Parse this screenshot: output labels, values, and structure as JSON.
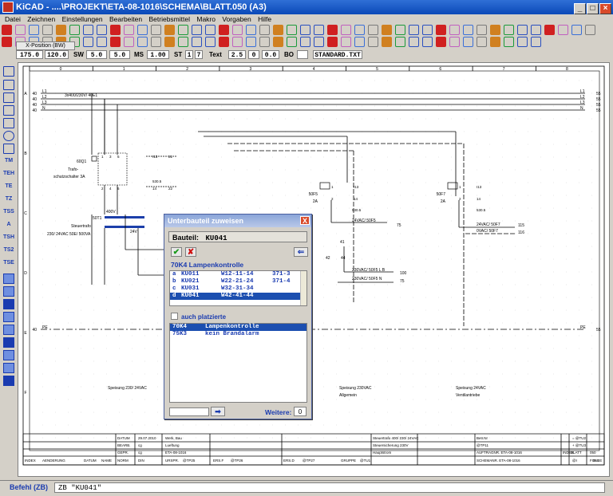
{
  "window": {
    "title": "KiCAD - ....\\PROJEKT\\ETA-08-1016\\SCHEMA\\BLATT.050 (A3)"
  },
  "menu": [
    "Datei",
    "Zeichnen",
    "Einstellungen",
    "Bearbeiten",
    "Betriebsmittel",
    "Makro",
    "Vorgaben",
    "Hilfe"
  ],
  "xpos_label": "X-Position (BW)",
  "status": {
    "v1": "175.0",
    "v2": "120.0",
    "sw_label": "SW",
    "sw": "5.0",
    "sw2": "5.0",
    "ms_label": "MS",
    "ms": "1.00",
    "st_label": "ST",
    "st1": "1",
    "st2": "7",
    "text_label": "Text",
    "text_size": "2.5",
    "tx1": "0",
    "tx2": "0.0",
    "bo_label": "BO",
    "font": "STANDARD.TXT"
  },
  "left_tools": [
    "TM",
    "TEH",
    "TE",
    "TZ",
    "TSS",
    "A",
    "TSH",
    "TS2",
    "TSE"
  ],
  "schematic": {
    "col_numbers": [
      "0",
      "1",
      "2",
      "3",
      "4",
      "5",
      "6",
      "7",
      "8"
    ],
    "row_letters": [
      "A",
      "B",
      "C",
      "D",
      "E",
      "F"
    ],
    "bus_label": "3x400/230V/ 40E1",
    "bus_left": [
      "L1",
      "L2",
      "L3",
      "N",
      "PE"
    ],
    "bus_right": [
      "L1",
      "L2",
      "L3",
      "N",
      "PE"
    ],
    "bus_refs": [
      "40",
      "40",
      "40",
      "40",
      "40"
    ],
    "bus_refs_right": [
      "55",
      "55",
      "55",
      "55",
      "55"
    ],
    "q1": {
      "name": "60Q1",
      "desc1": "Trafo-",
      "desc2": "schutzschalter 3A",
      "pins_top": [
        "1",
        "3",
        "5",
        "I13",
        "21"
      ],
      "pins_bot": [
        "2",
        "4",
        "6",
        "14",
        "22"
      ],
      "ref": "530.5"
    },
    "t1": {
      "name": "50T1",
      "desc1": "Steuertrafo",
      "desc2": "230/ 24VAC  50E/ 500VA",
      "v_in": "400V",
      "v_out": "24V"
    },
    "f5": {
      "name": "50F5",
      "rating": "2A",
      "pins": [
        "1",
        "I13",
        "2",
        "14"
      ],
      "ref": "530.5",
      "l1": "24VAC/ 50F5",
      "l1n": "75",
      "c1": "41",
      "c2": "42",
      "c3": "44",
      "l2": "230VAC/ 50F5 L B",
      "l2n": "100",
      "l3": "230VAC/ 50F5 N",
      "l3n": "75"
    },
    "f7": {
      "name": "50F7",
      "rating": "2A",
      "pins": [
        "1",
        "I13",
        "2",
        "14"
      ],
      "ref": "530.5",
      "l1": "24VAC/ 50F7",
      "l1n": "115",
      "l2": "0VAC/ 50F7",
      "l2n": "116"
    },
    "captions": [
      "Speisung 230/ 24VAC",
      "Speisung 230VAC",
      "Allgemein",
      "Speisung 24VAC",
      "Ventilantriebe"
    ],
    "titleblock": {
      "r1": [
        "DATUM",
        "29.07.2010",
        "Werk, Bau",
        "Steuertrafo 400/ 230/ 24VAC",
        "Betr.Nr",
        "= @TU2"
      ],
      "r2": [
        "BEARB.",
        "cg",
        "Lueftung",
        "Steuersicherung 230V",
        "@TP11",
        "+ @TU3"
      ],
      "r3": [
        "GEPR.",
        "cg",
        "ETA-08-1016",
        "Hauptstrom",
        "AUFTRAGNR. ETA-08-1016",
        "INDEX",
        "BLATT",
        "050"
      ],
      "r4": [
        "INDEX",
        "AENDERUNG",
        "DATUM",
        "NAME",
        "NORM",
        "DIN",
        "URSPR.",
        "@TP25",
        "ERS.F",
        "@TP26",
        "ERS.D",
        "@TP27",
        "GRUPPE",
        "@TU1",
        "SCHEMANR. ETA-08-1016",
        "@I",
        "FOLGE",
        "051"
      ]
    }
  },
  "dialog": {
    "title": "Unterbauteil zuweisen",
    "close": "X",
    "bauteil_label": "Bauteil:",
    "bauteil_value": "KU041",
    "ok": "✔",
    "cancel": "✘",
    "arrow": "⇐",
    "heading": "70K4  Lampenkontrolle",
    "items": [
      {
        "letter": "a",
        "code": "KU011",
        "pos": "W12-11-14",
        "ref": "371-3"
      },
      {
        "letter": "b",
        "code": "KU021",
        "pos": "W22-21-24",
        "ref": "371-4"
      },
      {
        "letter": "c",
        "code": "KU031",
        "pos": "W32-31-34",
        "ref": ""
      },
      {
        "letter": "d",
        "code": "KU041",
        "pos": "W42-41-44",
        "ref": ""
      }
    ],
    "checkbox_label": "auch platzierte",
    "list2": [
      {
        "code": "70K4",
        "label": "Lampenkontrolle"
      },
      {
        "code": "75K3",
        "label": "kein Brandalarm"
      }
    ],
    "go": "➡",
    "weitere_label": "Weitere:",
    "weitere_value": "0"
  },
  "command": {
    "label": "Befehl (ZB)",
    "value": "ZB \"KU041\""
  },
  "colors": {
    "accent": "#1a3bb0",
    "title_grad": "#0a49b8",
    "selection": "#1c4fb0"
  }
}
